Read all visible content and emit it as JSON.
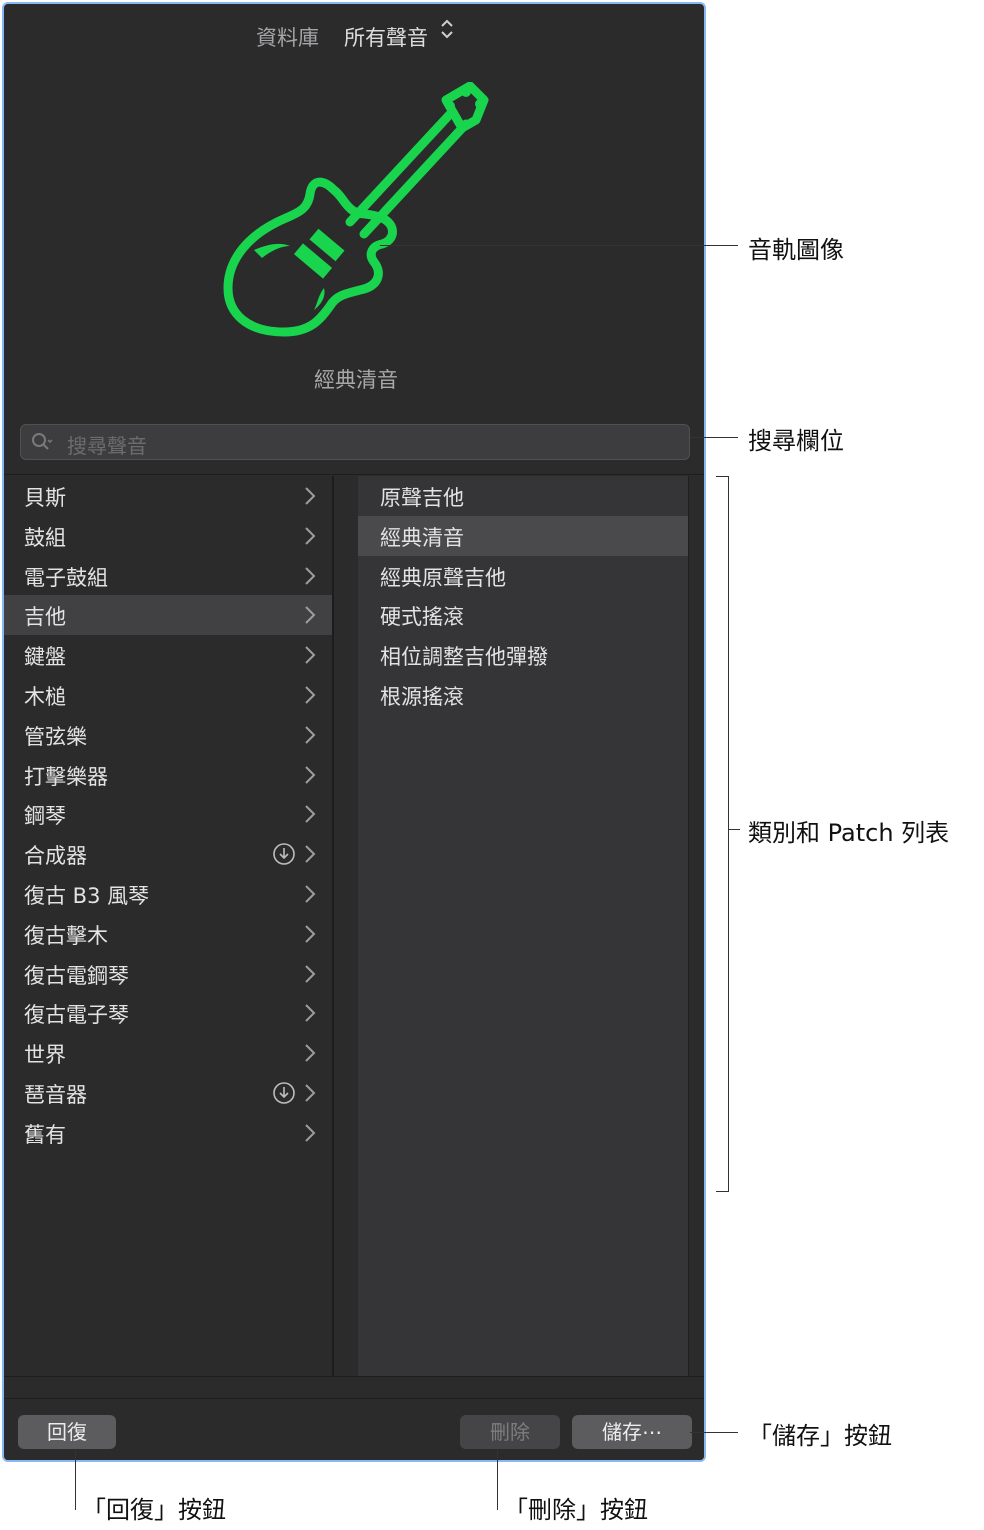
{
  "header": {
    "library_label": "資料庫",
    "library_value": "所有聲音"
  },
  "track_image": {
    "icon": "guitar-icon",
    "color": "#19d44d"
  },
  "patch_title": "經典清音",
  "search": {
    "placeholder": "搜尋聲音"
  },
  "categories": [
    {
      "label": "貝斯",
      "download": false
    },
    {
      "label": "鼓組",
      "download": false
    },
    {
      "label": "電子鼓組",
      "download": false
    },
    {
      "label": "吉他",
      "download": false,
      "selected": true
    },
    {
      "label": "鍵盤",
      "download": false
    },
    {
      "label": "木槌",
      "download": false
    },
    {
      "label": "管弦樂",
      "download": false
    },
    {
      "label": "打擊樂器",
      "download": false
    },
    {
      "label": "鋼琴",
      "download": false
    },
    {
      "label": "合成器",
      "download": true
    },
    {
      "label": "復古 B3 風琴",
      "download": false
    },
    {
      "label": "復古擊木",
      "download": false
    },
    {
      "label": "復古電鋼琴",
      "download": false
    },
    {
      "label": "復古電子琴",
      "download": false
    },
    {
      "label": "世界",
      "download": false
    },
    {
      "label": "琶音器",
      "download": true
    },
    {
      "label": "舊有",
      "download": false
    }
  ],
  "patches": [
    {
      "label": "原聲吉他"
    },
    {
      "label": "經典清音",
      "selected": true
    },
    {
      "label": "經典原聲吉他"
    },
    {
      "label": "硬式搖滾"
    },
    {
      "label": "相位調整吉他彈撥"
    },
    {
      "label": "根源搖滾"
    }
  ],
  "buttons": {
    "revert": "回復",
    "delete": "刪除",
    "save": "儲存⋯"
  },
  "callouts": {
    "track_image": "音軌圖像",
    "search_field": "搜尋欄位",
    "lists": "類別和 Patch 列表",
    "save_button": "「儲存」按鈕",
    "revert_button": "「回復」按鈕",
    "delete_button": "「刪除」按鈕"
  }
}
